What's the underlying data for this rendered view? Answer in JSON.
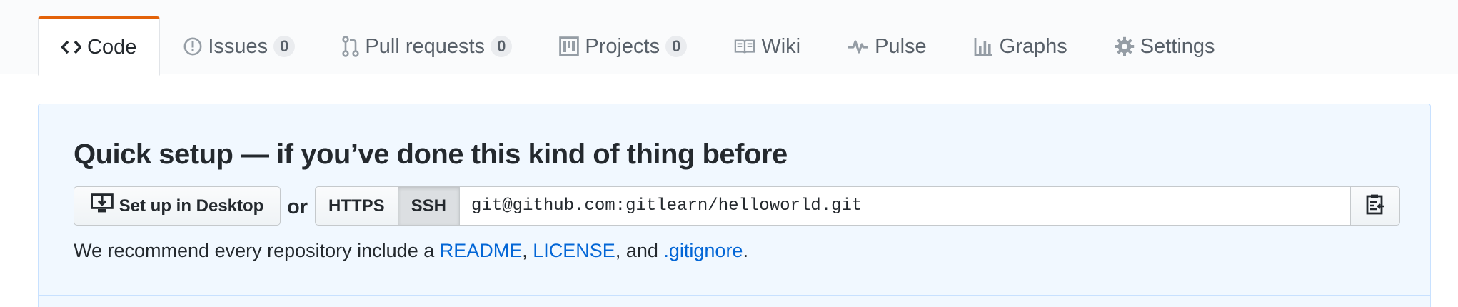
{
  "reponav": {
    "tabs": [
      {
        "label": "Code",
        "icon": "code-icon",
        "selected": true
      },
      {
        "label": "Issues",
        "icon": "issue-icon",
        "count": "0"
      },
      {
        "label": "Pull requests",
        "icon": "pull-request-icon",
        "count": "0"
      },
      {
        "label": "Projects",
        "icon": "project-icon",
        "count": "0"
      },
      {
        "label": "Wiki",
        "icon": "book-icon"
      },
      {
        "label": "Pulse",
        "icon": "pulse-icon"
      },
      {
        "label": "Graphs",
        "icon": "graph-icon"
      },
      {
        "label": "Settings",
        "icon": "gear-icon"
      }
    ],
    "accent_color": "#e36209"
  },
  "quick_setup": {
    "title": "Quick setup — if you’ve done this kind of thing before",
    "desktop_button_label": "Set up in Desktop",
    "or_label": "or",
    "protocols": {
      "https_label": "HTTPS",
      "ssh_label": "SSH",
      "selected": "SSH"
    },
    "clone_url": "git@github.com:gitlearn/helloworld.git",
    "copy_icon": "clippy-icon",
    "recommend": {
      "prefix": "We recommend every repository include a ",
      "readme": "README",
      "sep1": ", ",
      "license": "LICENSE",
      "sep2": ", and ",
      "gitignore": ".gitignore",
      "suffix": "."
    },
    "background_color": "#f1f8ff",
    "link_color": "#0366d6"
  }
}
